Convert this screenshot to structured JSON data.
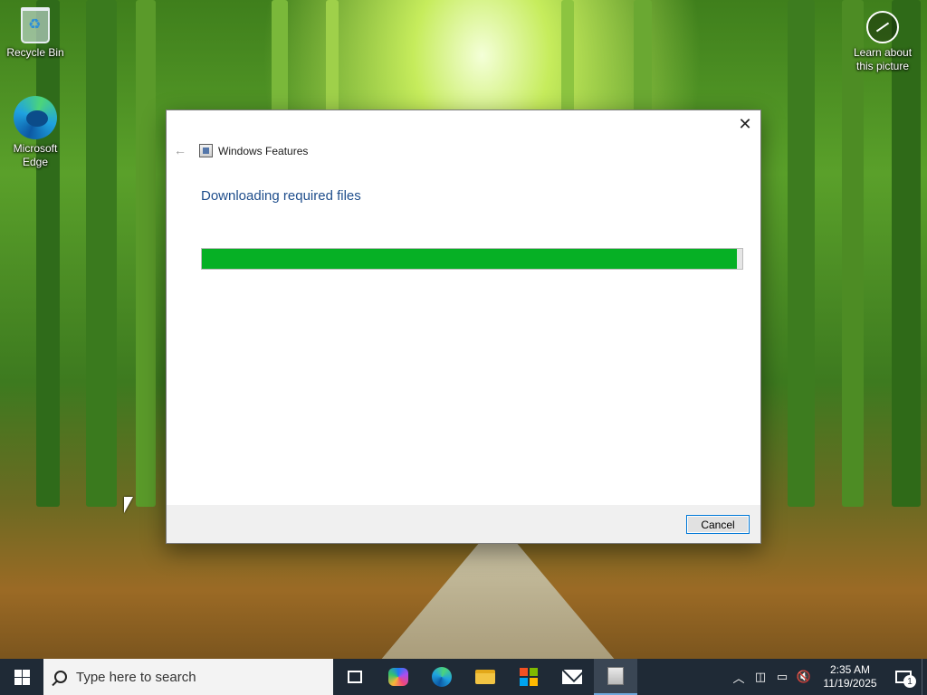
{
  "desktop": {
    "icons": [
      {
        "label": "Recycle Bin",
        "icon": "recycle-bin-icon"
      },
      {
        "label": "Microsoft Edge",
        "icon": "edge-icon"
      }
    ],
    "learn_label": "Learn about this picture",
    "learn_icon": "camera-info-icon"
  },
  "dialog": {
    "title": "Windows Features",
    "heading": "Downloading required files",
    "progress_fraction": 0.99,
    "progress_color": "#06b025",
    "cancel_label": "Cancel",
    "close_glyph": "✕",
    "back_glyph": "←"
  },
  "taskbar": {
    "search_placeholder": "Type here to search",
    "pinned": [
      "task-view",
      "copilot",
      "edge",
      "file-explorer",
      "microsoft-store",
      "mail",
      "windows-features"
    ],
    "time": "2:35 AM",
    "date": "11/19/2025",
    "notification_count": "1",
    "tray_icons": [
      "chevron-up-icon",
      "meet-now-icon",
      "network-icon",
      "volume-muted-icon"
    ]
  },
  "colors": {
    "accent": "#0078d7",
    "heading_blue": "#1f4e8c",
    "taskbar_bg": "#1f2a36"
  }
}
